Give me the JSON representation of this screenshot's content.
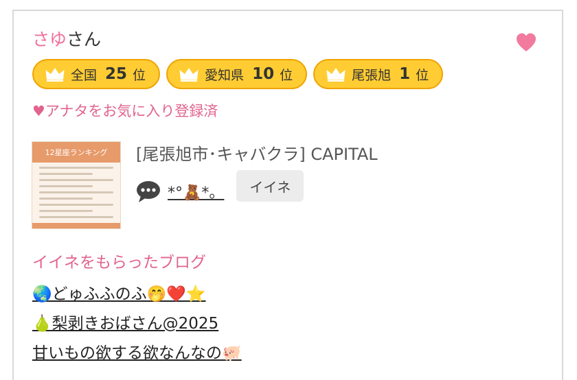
{
  "user": {
    "name_first": "さゆ",
    "name_suffix": "さん"
  },
  "favorite_icon": "heart-icon",
  "colors": {
    "pink": "#f0709a",
    "badge_fill": "#ffcc33",
    "badge_border": "#f0a300"
  },
  "rank_badges": [
    {
      "region": "全国",
      "rank": "25",
      "unit": "位",
      "icon": "crown-icon"
    },
    {
      "region": "愛知県",
      "rank": "10",
      "unit": "位",
      "icon": "crown-icon"
    },
    {
      "region": "尾張旭",
      "rank": "1",
      "unit": "位",
      "icon": "crown-icon"
    }
  ],
  "favorite_status": "♥アナタをお気に入り登録済",
  "post": {
    "title": "[尾張旭市･キャバクラ]  CAPITAL",
    "thumbnail_header": "12星座ランキング",
    "comment_icon": "speech-bubble-icon",
    "commenter": "*°🧸*。",
    "like_label": "イイネ"
  },
  "blog_section": {
    "heading": "イイネをもらったブログ",
    "links": [
      "🌏どゅふふのふ🤭❤️⭐",
      "🍐梨剥きおばさん@2025",
      "甘いもの欲する欲なんなの🐖"
    ]
  }
}
